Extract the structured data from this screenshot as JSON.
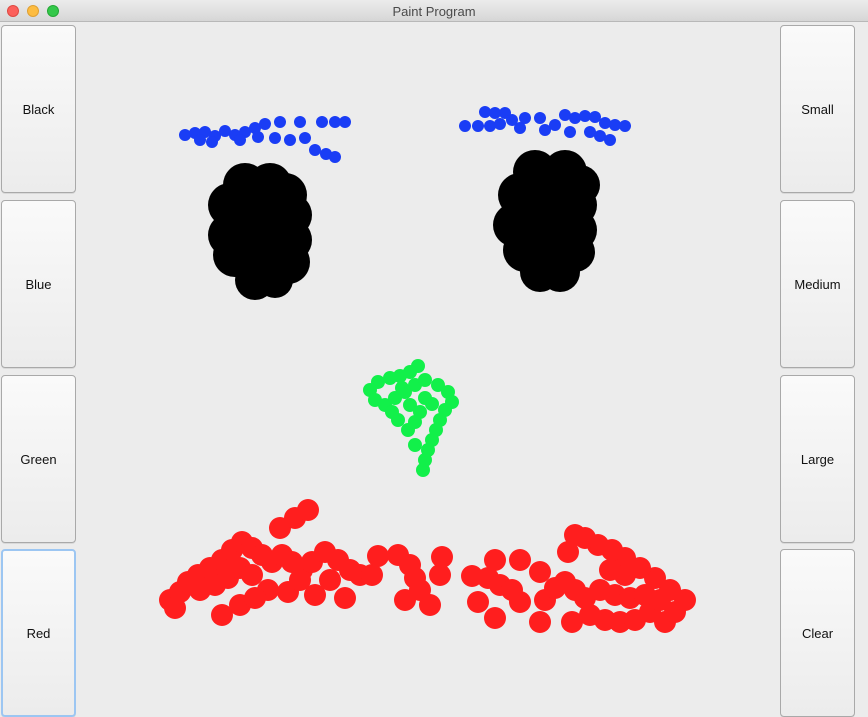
{
  "window": {
    "title": "Paint Program"
  },
  "colors": {
    "blue": "#1a3df5",
    "black": "#000000",
    "green": "#12f04a",
    "red": "#ff1e1e"
  },
  "left_buttons": [
    "Black",
    "Blue",
    "Green",
    "Red"
  ],
  "right_buttons": [
    "Small",
    "Medium",
    "Large",
    "Clear"
  ]
}
